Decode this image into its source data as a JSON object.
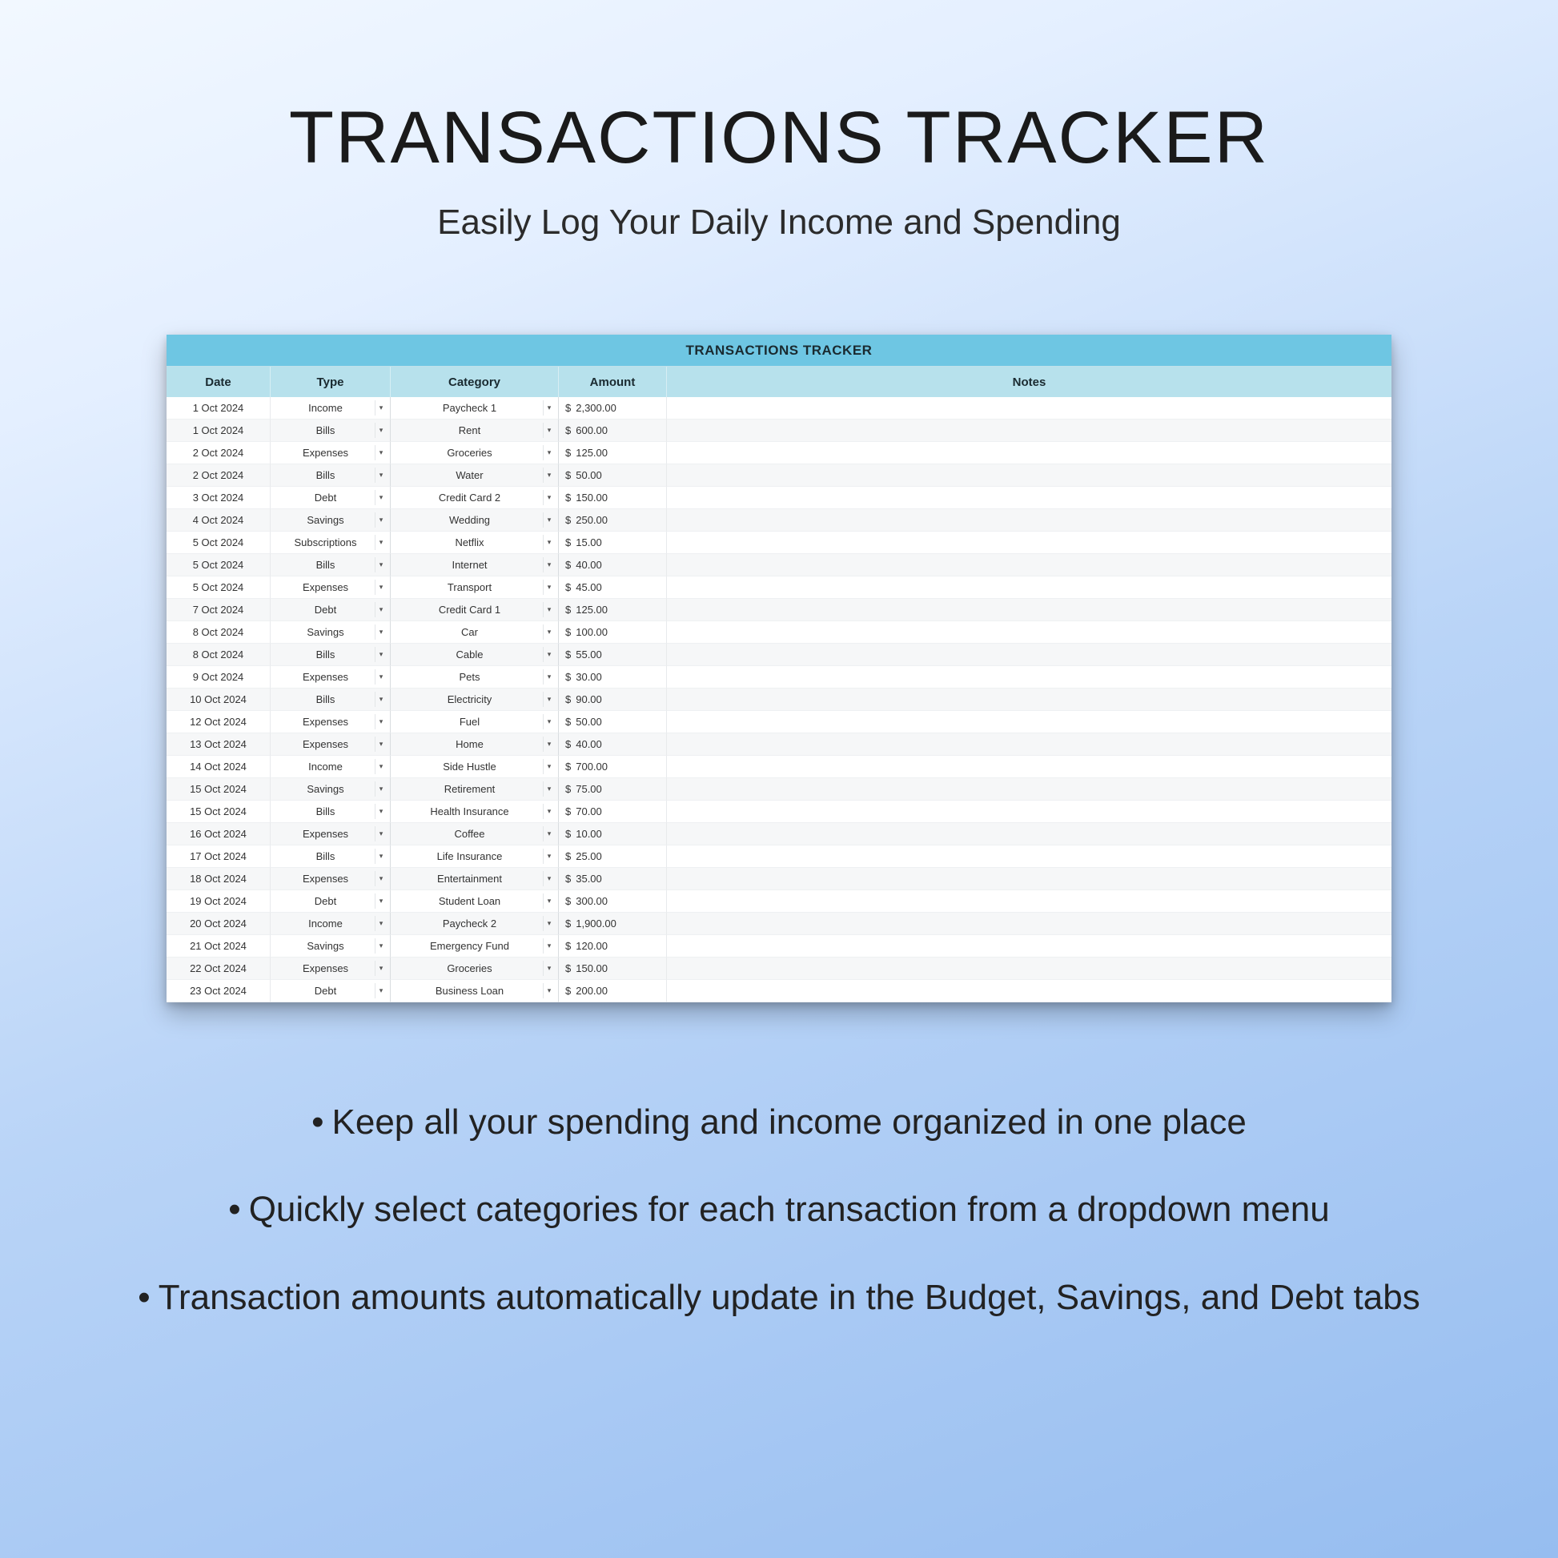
{
  "title": "TRANSACTIONS TRACKER",
  "subtitle": "Easily Log Your Daily Income and Spending",
  "sheet": {
    "title": "TRANSACTIONS TRACKER",
    "headers": {
      "date": "Date",
      "type": "Type",
      "category": "Category",
      "amount": "Amount",
      "notes": "Notes"
    },
    "currency_symbol": "$",
    "rows": [
      {
        "date": "1 Oct 2024",
        "type": "Income",
        "category": "Paycheck 1",
        "amount": "2,300.00",
        "notes": ""
      },
      {
        "date": "1 Oct 2024",
        "type": "Bills",
        "category": "Rent",
        "amount": "600.00",
        "notes": ""
      },
      {
        "date": "2 Oct 2024",
        "type": "Expenses",
        "category": "Groceries",
        "amount": "125.00",
        "notes": ""
      },
      {
        "date": "2 Oct 2024",
        "type": "Bills",
        "category": "Water",
        "amount": "50.00",
        "notes": ""
      },
      {
        "date": "3 Oct 2024",
        "type": "Debt",
        "category": "Credit Card 2",
        "amount": "150.00",
        "notes": ""
      },
      {
        "date": "4 Oct 2024",
        "type": "Savings",
        "category": "Wedding",
        "amount": "250.00",
        "notes": ""
      },
      {
        "date": "5 Oct 2024",
        "type": "Subscriptions",
        "category": "Netflix",
        "amount": "15.00",
        "notes": ""
      },
      {
        "date": "5 Oct 2024",
        "type": "Bills",
        "category": "Internet",
        "amount": "40.00",
        "notes": ""
      },
      {
        "date": "5 Oct 2024",
        "type": "Expenses",
        "category": "Transport",
        "amount": "45.00",
        "notes": ""
      },
      {
        "date": "7 Oct 2024",
        "type": "Debt",
        "category": "Credit Card 1",
        "amount": "125.00",
        "notes": ""
      },
      {
        "date": "8 Oct 2024",
        "type": "Savings",
        "category": "Car",
        "amount": "100.00",
        "notes": ""
      },
      {
        "date": "8 Oct 2024",
        "type": "Bills",
        "category": "Cable",
        "amount": "55.00",
        "notes": ""
      },
      {
        "date": "9 Oct 2024",
        "type": "Expenses",
        "category": "Pets",
        "amount": "30.00",
        "notes": ""
      },
      {
        "date": "10 Oct 2024",
        "type": "Bills",
        "category": "Electricity",
        "amount": "90.00",
        "notes": ""
      },
      {
        "date": "12 Oct 2024",
        "type": "Expenses",
        "category": "Fuel",
        "amount": "50.00",
        "notes": ""
      },
      {
        "date": "13 Oct 2024",
        "type": "Expenses",
        "category": "Home",
        "amount": "40.00",
        "notes": ""
      },
      {
        "date": "14 Oct 2024",
        "type": "Income",
        "category": "Side Hustle",
        "amount": "700.00",
        "notes": ""
      },
      {
        "date": "15 Oct 2024",
        "type": "Savings",
        "category": "Retirement",
        "amount": "75.00",
        "notes": ""
      },
      {
        "date": "15 Oct 2024",
        "type": "Bills",
        "category": "Health Insurance",
        "amount": "70.00",
        "notes": ""
      },
      {
        "date": "16 Oct 2024",
        "type": "Expenses",
        "category": "Coffee",
        "amount": "10.00",
        "notes": ""
      },
      {
        "date": "17 Oct 2024",
        "type": "Bills",
        "category": "Life Insurance",
        "amount": "25.00",
        "notes": ""
      },
      {
        "date": "18 Oct 2024",
        "type": "Expenses",
        "category": "Entertainment",
        "amount": "35.00",
        "notes": ""
      },
      {
        "date": "19 Oct 2024",
        "type": "Debt",
        "category": "Student Loan",
        "amount": "300.00",
        "notes": ""
      },
      {
        "date": "20 Oct 2024",
        "type": "Income",
        "category": "Paycheck 2",
        "amount": "1,900.00",
        "notes": ""
      },
      {
        "date": "21 Oct 2024",
        "type": "Savings",
        "category": "Emergency Fund",
        "amount": "120.00",
        "notes": ""
      },
      {
        "date": "22 Oct 2024",
        "type": "Expenses",
        "category": "Groceries",
        "amount": "150.00",
        "notes": ""
      },
      {
        "date": "23 Oct 2024",
        "type": "Debt",
        "category": "Business Loan",
        "amount": "200.00",
        "notes": ""
      }
    ]
  },
  "bullets": [
    "Keep all your spending and income organized in one place",
    "Quickly select categories for each transaction from a dropdown menu",
    "Transaction amounts automatically update in the Budget, Savings, and Debt tabs"
  ]
}
